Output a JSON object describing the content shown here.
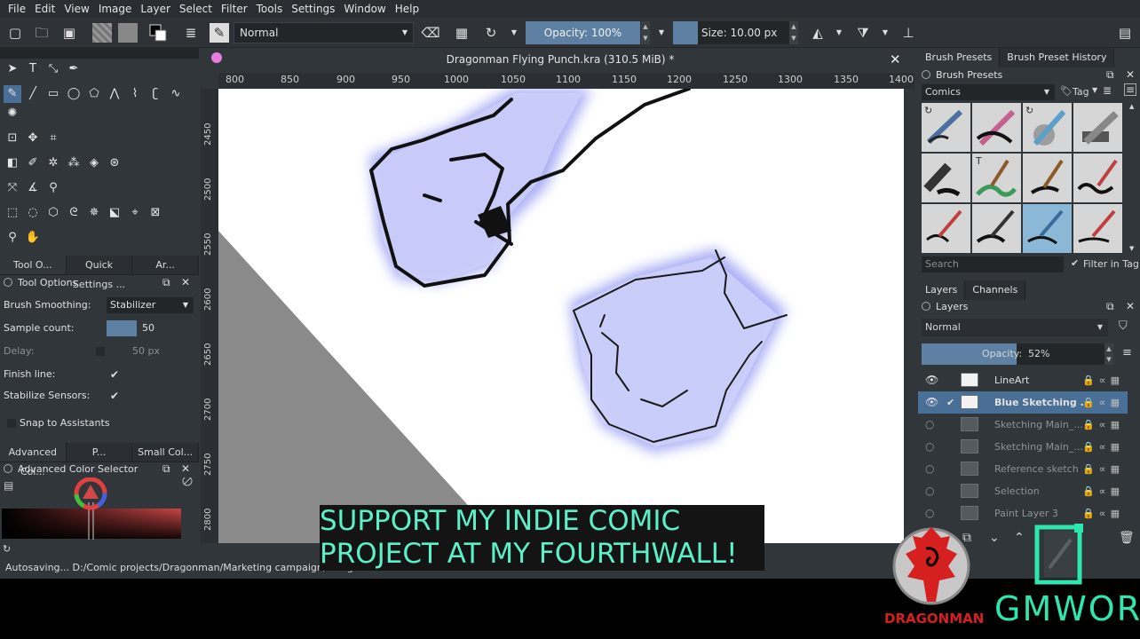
{
  "menu": [
    "File",
    "Edit",
    "View",
    "Image",
    "Layer",
    "Select",
    "Filter",
    "Tools",
    "Settings",
    "Window",
    "Help"
  ],
  "toolbar": {
    "blend_mode": "Normal",
    "opacity_label": "Opacity: 100%",
    "size_label": "Size: 10.00 px"
  },
  "document": {
    "title": "Dragonman Flying Punch.kra (310.5 MiB) *"
  },
  "ruler_h": [
    "800",
    "850",
    "900",
    "950",
    "1000",
    "1050",
    "1100",
    "1150",
    "1200",
    "1250",
    "1300",
    "1350",
    "1400"
  ],
  "ruler_v": [
    "2450",
    "2500",
    "2550",
    "2600",
    "2650",
    "2700",
    "2750",
    "2800"
  ],
  "left_tabs": [
    "Tool O...",
    "Quick Settings ...",
    "Ar..."
  ],
  "tool_options": {
    "title": "Tool Options",
    "brush_smoothing_label": "Brush Smoothing:",
    "brush_smoothing_value": "Stabilizer",
    "sample_count_label": "Sample count:",
    "sample_count_value": "50",
    "delay_label": "Delay:",
    "delay_value": "50 px",
    "finish_line_label": "Finish line:",
    "stabilize_sensors_label": "Stabilize Sensors:",
    "snap_label": "Snap to Assistants"
  },
  "color_tabs": [
    "Advanced Col...",
    "P...",
    "Small Col..."
  ],
  "color_panel_title": "Advanced Color Selector",
  "status": "Autosaving... D:/Comic projects/Dragonman/Marketing campaign/.Drag",
  "right_tabs": [
    "Brush Presets",
    "Brush Preset History"
  ],
  "brush_presets": {
    "title": "Brush Presets",
    "tag_filter": "Comics",
    "tag_label": "Tag",
    "search_placeholder": "Search",
    "filter_label": "Filter in Tag"
  },
  "layer_tabs": [
    "Layers",
    "Channels"
  ],
  "layers_panel": {
    "title": "Layers",
    "blend_mode": "Normal",
    "opacity_label": "Opacity:",
    "opacity_value": "52%",
    "opacity_fraction": 0.52,
    "layers": [
      {
        "name": "LineArt",
        "visible": true,
        "selected": false
      },
      {
        "name": "Blue Sketching ...",
        "visible": true,
        "selected": true
      },
      {
        "name": "Sketching Main_...",
        "visible": false,
        "selected": false
      },
      {
        "name": "Sketching Main_...",
        "visible": false,
        "selected": false
      },
      {
        "name": "Reference sketch",
        "visible": false,
        "selected": false
      },
      {
        "name": "Selection",
        "visible": false,
        "selected": false
      },
      {
        "name": "Paint Layer 3",
        "visible": false,
        "selected": false
      }
    ]
  },
  "caption": {
    "line1": "SUPPORT MY INDIE COMIC",
    "line2": "PROJECT AT MY FOURTHWALL!"
  },
  "brand": {
    "dragonman": "DRAGONMAN",
    "gmwor": "GMWOR"
  },
  "colors": {
    "accent": "#5e81a3",
    "caption_text": "#5cf0c8",
    "logo_red": "#d62020",
    "logo_teal": "#2ee6b0"
  }
}
